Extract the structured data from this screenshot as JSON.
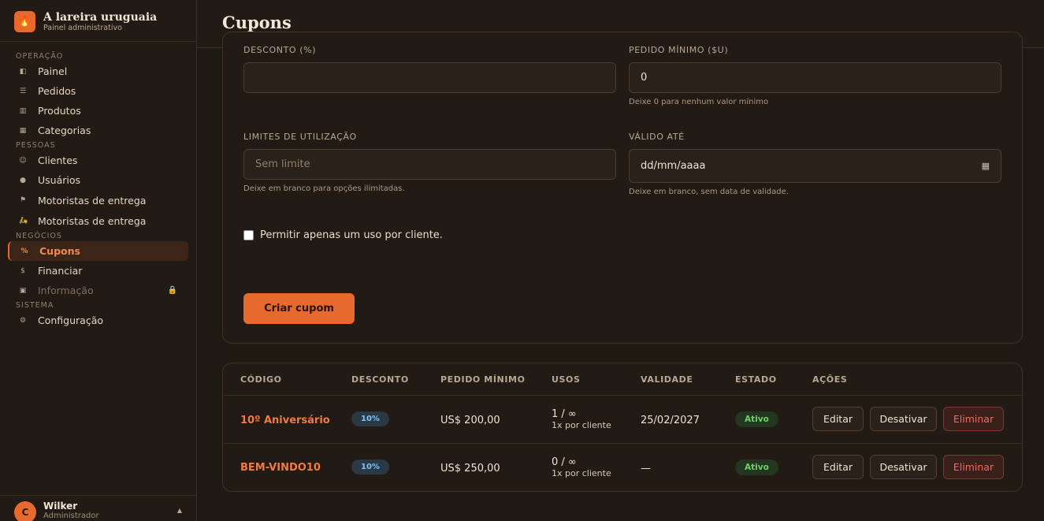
{
  "brand": {
    "title": "A lareira uruguaia",
    "subtitle": "Painel administrativo",
    "logo_icon": "flame-icon"
  },
  "sidebar": {
    "sections": [
      {
        "label": "OPERAÇÃO",
        "items": [
          {
            "label": "Painel",
            "icon": "dashboard-icon"
          },
          {
            "label": "Pedidos",
            "icon": "orders-icon"
          },
          {
            "label": "Produtos",
            "icon": "products-icon"
          },
          {
            "label": "Categorias",
            "icon": "categories-icon"
          }
        ]
      },
      {
        "label": "PESSOAS",
        "items": [
          {
            "label": "Clientes",
            "icon": "clients-icon"
          },
          {
            "label": "Usuários",
            "icon": "users-icon"
          },
          {
            "label": "Motoristas de entrega",
            "icon": "flag-icon"
          },
          {
            "label": "Motoristas de entrega",
            "icon": "scooter-icon"
          }
        ]
      },
      {
        "label": "NEGÓCIOS",
        "items": [
          {
            "label": "Cupons",
            "icon": "percent-icon",
            "active": true
          },
          {
            "label": "Financiar",
            "icon": "dollar-icon"
          },
          {
            "label": "Informação",
            "icon": "report-icon",
            "locked": true
          }
        ]
      },
      {
        "label": "SISTEMA",
        "items": [
          {
            "label": "Configuração",
            "icon": "gear-icon"
          }
        ]
      }
    ]
  },
  "user": {
    "initial": "C",
    "name": "Wilker",
    "role": "Administrador"
  },
  "header": {
    "title": "Cupons"
  },
  "form": {
    "discount": {
      "label": "DESCONTO (%)",
      "value": ""
    },
    "min_order": {
      "label": "PEDIDO MÍNIMO ($U)",
      "value": "0",
      "hint": "Deixe 0 para nenhum valor mínimo"
    },
    "usage_limit": {
      "label": "LIMITES DE UTILIZAÇÃO",
      "placeholder": "Sem limite",
      "hint": "Deixe em branco para opções ilimitadas."
    },
    "valid_until": {
      "label": "VÁLIDO ATÉ",
      "value": "dd/mm/aaaa",
      "hint": "Deixe em branco, sem data de validade."
    },
    "one_per_client": {
      "label": "Permitir apenas um uso por cliente.",
      "checked": false
    },
    "submit_label": "Criar cupom"
  },
  "table": {
    "headers": [
      "CÓDIGO",
      "DESCONTO",
      "PEDIDO MÍNIMO",
      "USOS",
      "VALIDADE",
      "ESTADO",
      "AÇÕES"
    ],
    "rows": [
      {
        "code": "10º Aniversário",
        "discount": "10%",
        "min_order": "US$ 200,00",
        "uses": "1 / ∞",
        "uses_note": "1x por cliente",
        "validity": "25/02/2027",
        "status": "Ativo"
      },
      {
        "code": "BEM-VINDO10",
        "discount": "10%",
        "min_order": "US$ 250,00",
        "uses": "0 / ∞",
        "uses_note": "1x por cliente",
        "validity": "—",
        "status": "Ativo"
      }
    ],
    "actions": {
      "edit": "Editar",
      "deactivate": "Desativar",
      "delete": "Eliminar"
    }
  },
  "colors": {
    "accent": "#e8692e",
    "background": "#1f1914",
    "panel": "#221b15",
    "success": "#6ed26b",
    "danger": "#ef6b5e"
  }
}
